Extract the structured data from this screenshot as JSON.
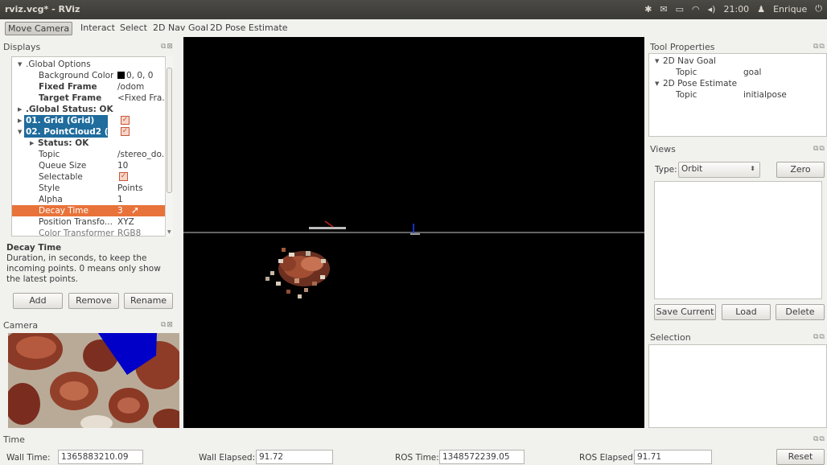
{
  "window": {
    "title": "rviz.vcg* - RViz"
  },
  "tray": {
    "time": "21:00",
    "user": "Enrique"
  },
  "toolbar": {
    "tools": [
      "Move Camera",
      "Interact",
      "Select",
      "2D Nav Goal",
      "2D Pose Estimate"
    ],
    "active": "Move Camera"
  },
  "displays": {
    "title": "Displays",
    "rows": [
      {
        "key": ".Global Options",
        "value": ""
      },
      {
        "key": "Background Color",
        "value": "0, 0, 0"
      },
      {
        "key": "Fixed Frame",
        "value": "/odom"
      },
      {
        "key": "Target Frame",
        "value": "<Fixed Fra.."
      },
      {
        "key": ".Global Status: OK",
        "value": ""
      },
      {
        "key": "01. Grid (Grid)",
        "value": ""
      },
      {
        "key": "02. PointCloud2 (P...",
        "value": ""
      },
      {
        "key": "Status: OK",
        "value": ""
      },
      {
        "key": "Topic",
        "value": "/stereo_do.."
      },
      {
        "key": "Queue Size",
        "value": "10"
      },
      {
        "key": "Selectable",
        "value": ""
      },
      {
        "key": "Style",
        "value": "Points"
      },
      {
        "key": "Alpha",
        "value": "1"
      },
      {
        "key": "Decay Time",
        "value": "3"
      },
      {
        "key": "Position Transfo...",
        "value": "XYZ"
      },
      {
        "key": "Color Transformer",
        "value": "RGB8"
      }
    ],
    "desc_title": "Decay Time",
    "desc_text": "Duration, in seconds, to keep the incoming points. 0 means only show the latest points.",
    "buttons": {
      "add": "Add",
      "remove": "Remove",
      "rename": "Rename"
    }
  },
  "camera": {
    "title": "Camera"
  },
  "tool_properties": {
    "title": "Tool Properties",
    "rows": [
      {
        "key": "2D Nav Goal",
        "value": ""
      },
      {
        "key": "Topic",
        "value": "goal"
      },
      {
        "key": "2D Pose Estimate",
        "value": ""
      },
      {
        "key": "Topic",
        "value": "initialpose"
      }
    ]
  },
  "views": {
    "title": "Views",
    "type_label": "Type:",
    "type_value": "Orbit",
    "zero": "Zero",
    "save_current": "Save Current",
    "load": "Load",
    "delete": "Delete"
  },
  "selection": {
    "title": "Selection"
  },
  "time": {
    "title": "Time",
    "wall_time_label": "Wall Time:",
    "wall_time": "1365883210.09",
    "wall_elapsed_label": "Wall Elapsed:",
    "wall_elapsed": "91.72",
    "ros_time_label": "ROS Time:",
    "ros_time": "1348572239.05",
    "ros_elapsed_label": "ROS Elapsed:",
    "ros_elapsed": "91.71",
    "reset": "Reset"
  },
  "colors": {
    "selection_blue": "#1f6c9d",
    "highlight_orange": "#e8733a",
    "viewport_bg": "#000000",
    "grid_line": "#a0a0a0"
  }
}
